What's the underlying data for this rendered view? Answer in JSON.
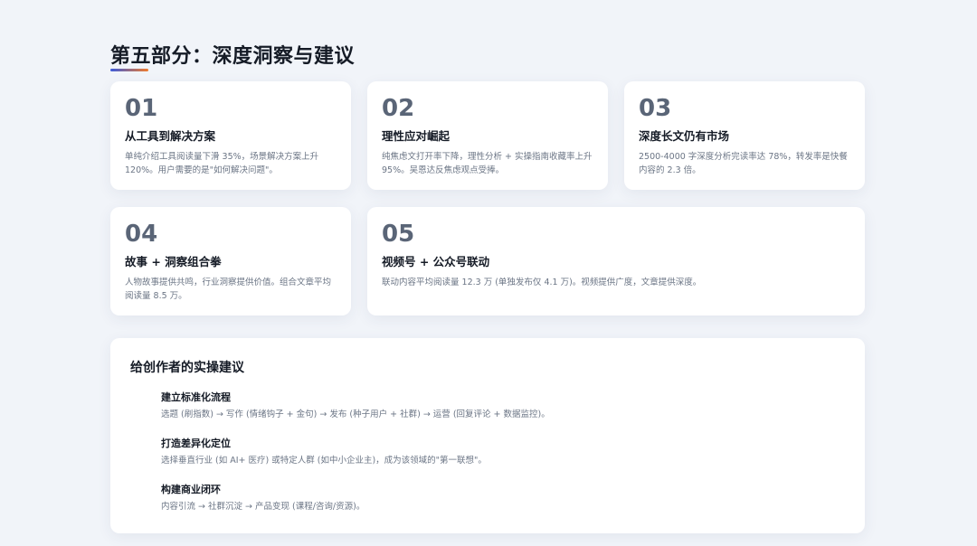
{
  "title": "第五部分：深度洞察与建议",
  "colors": {
    "accent_start": "#3b5bdb",
    "accent_end": "#f07a2c",
    "number": "#5a6577",
    "background": "#f1f4f9"
  },
  "cards": [
    {
      "num": "01",
      "title": "从工具到解决方案",
      "desc": "单纯介绍工具阅读量下滑 35%，场景解决方案上升 120%。用户需要的是\"如何解决问题\"。"
    },
    {
      "num": "02",
      "title": "理性应对崛起",
      "desc": "纯焦虑文打开率下降，理性分析 + 实操指南收藏率上升 95%。吴恩达反焦虑观点受捧。"
    },
    {
      "num": "03",
      "title": "深度长文仍有市场",
      "desc": "2500-4000 字深度分析完读率达 78%，转发率是快餐内容的 2.3 倍。"
    },
    {
      "num": "04",
      "title": "故事 + 洞察组合拳",
      "desc": "人物故事提供共鸣，行业洞察提供价值。组合文章平均阅读量 8.5 万。"
    },
    {
      "num": "05",
      "title": "视频号 + 公众号联动",
      "desc": "联动内容平均阅读量 12.3 万 (单独发布仅 4.1 万)。视频提供广度，文章提供深度。"
    }
  ],
  "advice": {
    "title": "给创作者的实操建议",
    "items": [
      {
        "title": "建立标准化流程",
        "desc": "选题 (刷指数) → 写作 (情绪钩子 + 金句) → 发布 (种子用户 + 社群) → 运营 (回复评论 + 数据监控)。"
      },
      {
        "title": "打造差异化定位",
        "desc": "选择垂直行业 (如 AI+ 医疗) 或特定人群 (如中小企业主)，成为该领域的\"第一联想\"。"
      },
      {
        "title": "构建商业闭环",
        "desc": "内容引流 → 社群沉淀 → 产品变现 (课程/咨询/资源)。"
      }
    ]
  }
}
